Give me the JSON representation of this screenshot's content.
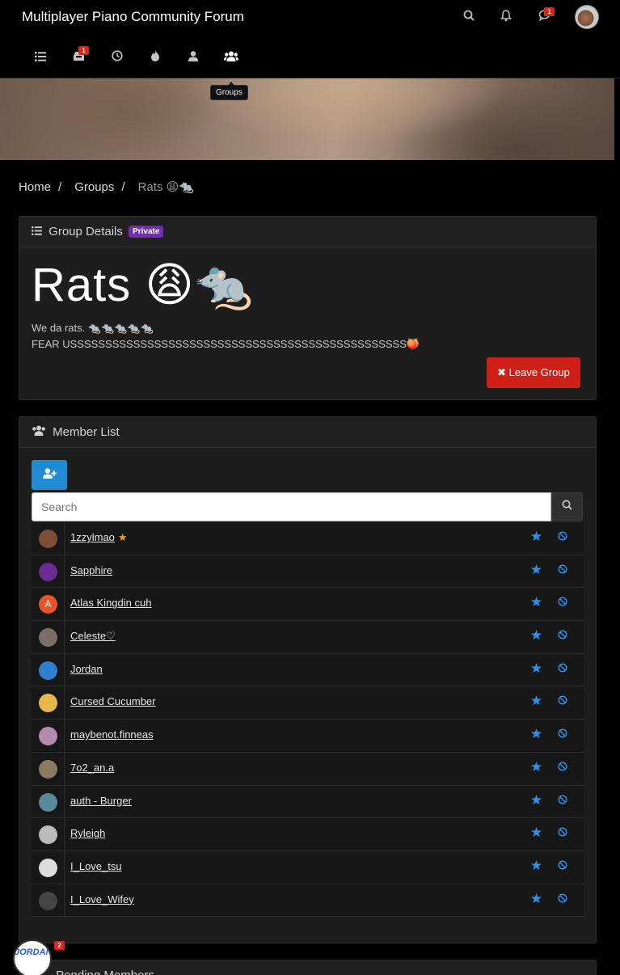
{
  "header": {
    "brand": "Multiplayer Piano Community Forum",
    "chat_badge": "1",
    "tooltip": "Groups",
    "unread_badge": "1"
  },
  "breadcrumb": {
    "home": "Home",
    "groups": "Groups",
    "current": "Rats 😩🐀"
  },
  "details": {
    "header": "Group Details",
    "privacy": "Private",
    "name": "Rats 😩🐀",
    "desc_line1": "We da rats. 🐀🐀🐀🐀🐀",
    "desc_line2": "FEAR USSSSSSSSSSSSSSSSSSSSSSSSSSSSSSSSSSSSSSSSSSSSSSSS🍑",
    "leave_label": "Leave Group"
  },
  "member_list": {
    "header": "Member List",
    "search_placeholder": "Search",
    "members": [
      {
        "name": "1zzylmao",
        "initial": "",
        "color": "#7a4f36"
      },
      {
        "name": "Sapphire",
        "initial": "",
        "color": "#6a2c8e"
      },
      {
        "name": "Atlas Kingdin cuh",
        "initial": "A",
        "color": "#e8542a"
      },
      {
        "name": "Celeste♡",
        "initial": "",
        "color": "#7b6e6a"
      },
      {
        "name": "Jordan",
        "initial": "",
        "color": "#2f7fd0"
      },
      {
        "name": "Cursed Cucumber",
        "initial": "",
        "color": "#e6b84a"
      },
      {
        "name": "maybenot.finneas",
        "initial": "",
        "color": "#b58ab0"
      },
      {
        "name": "7o2_an.a",
        "initial": "",
        "color": "#8a7a60"
      },
      {
        "name": "auth - Burger",
        "initial": "",
        "color": "#5a8a98"
      },
      {
        "name": "Ryleigh",
        "initial": "",
        "color": "#bbbbbb"
      },
      {
        "name": "I_Love_tsu",
        "initial": "",
        "color": "#dddddd"
      },
      {
        "name": "I_Love_Wifey",
        "initial": "",
        "color": "#444444"
      }
    ]
  },
  "pending": {
    "header": "Pending Members"
  },
  "floating_chat": {
    "label": "JORDAN",
    "badge": "2"
  },
  "colors": {
    "accent": "#1e8bd2",
    "danger": "#cf2018",
    "private": "#6f2fb0",
    "badge": "#d9261c"
  }
}
